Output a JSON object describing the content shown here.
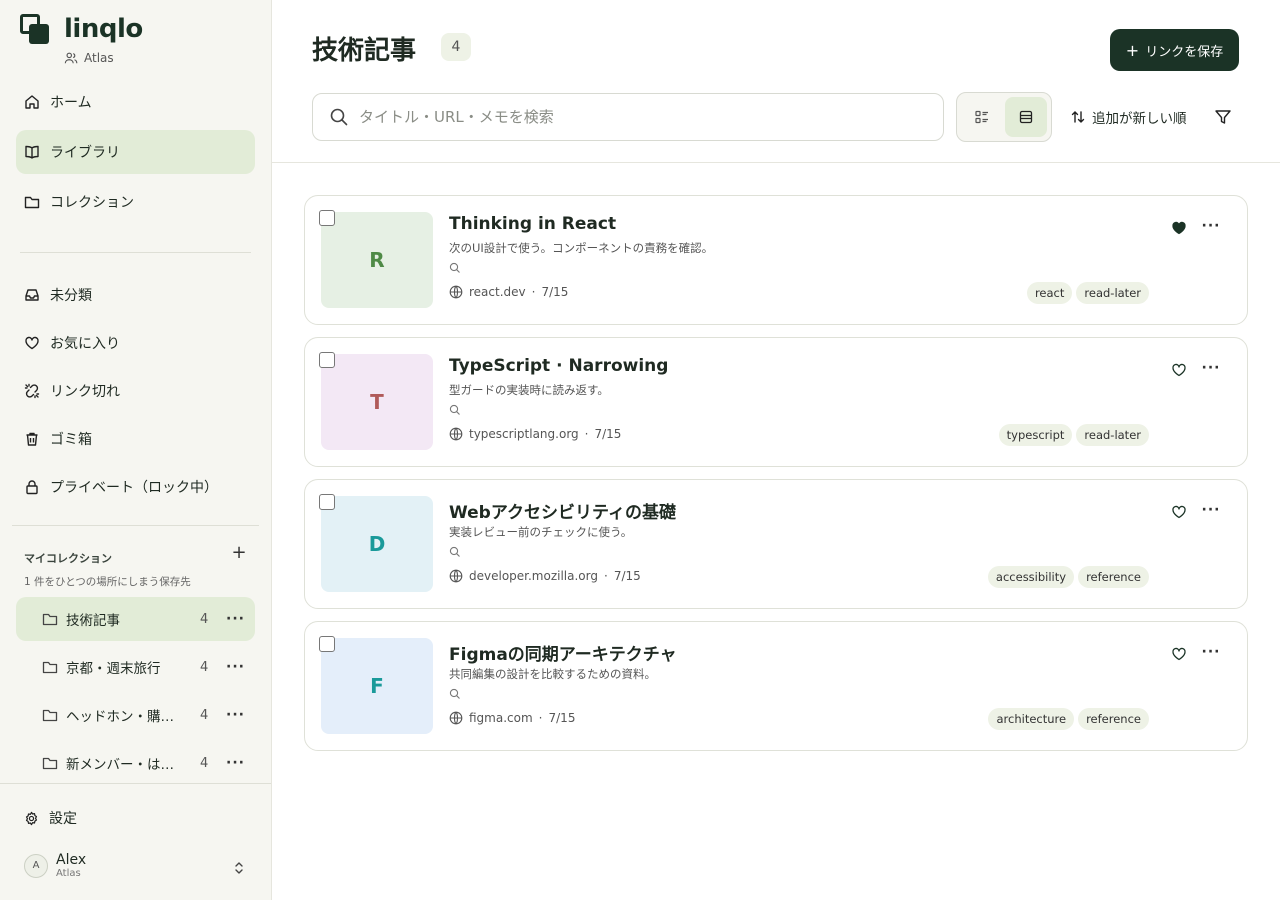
{
  "app": {
    "name": "linqlo",
    "workspace": "Atlas"
  },
  "sidebar": {
    "nav": [
      {
        "label": "ホーム",
        "icon": "home-icon"
      },
      {
        "label": "ライブラリ",
        "icon": "book-icon",
        "active": true
      },
      {
        "label": "コレクション",
        "icon": "folder-icon"
      }
    ],
    "filters": [
      {
        "label": "未分類",
        "icon": "inbox-icon"
      },
      {
        "label": "お気に入り",
        "icon": "heart-icon"
      },
      {
        "label": "リンク切れ",
        "icon": "broken-link-icon"
      },
      {
        "label": "ゴミ箱",
        "icon": "trash-icon"
      },
      {
        "label": "プライベート（ロック中）",
        "icon": "lock-icon"
      }
    ],
    "collections_title": "マイコレクション",
    "collections_desc": "1 件をひとつの場所にしまう保存先",
    "collections": [
      {
        "name": "技術記事",
        "count": "4",
        "active": true
      },
      {
        "name": "京都・週末旅行",
        "count": "4"
      },
      {
        "name": "ヘッドホン・購…",
        "count": "4"
      },
      {
        "name": "新メンバー・は…",
        "count": "4"
      }
    ],
    "settings_label": "設定",
    "user": {
      "initial": "A",
      "name": "Alex",
      "workspace": "Atlas"
    }
  },
  "main": {
    "title": "技術記事",
    "count": "4",
    "save_button": "リンクを保存",
    "search_placeholder": "タイトル・URL・メモを検索",
    "sort_label": "追加が新しい順"
  },
  "colors": {
    "accent": "#1b3326",
    "active_bg": "#e2ecd7"
  },
  "cards": [
    {
      "initial": "R",
      "thumb_bg": "#e6f0e4",
      "thumb_fg": "#4f8a46",
      "title": "Thinking in React",
      "memo": "次のUI設計で使う。コンポーネントの責務を確認。",
      "domain": "react.dev",
      "date": "7/15",
      "tags": [
        "react",
        "read-later"
      ],
      "favorite": true
    },
    {
      "initial": "T",
      "thumb_bg": "#f3e8f5",
      "thumb_fg": "#b05a5a",
      "title": "TypeScript · Narrowing",
      "memo": "型ガードの実装時に読み返す。",
      "domain": "typescriptlang.org",
      "date": "7/15",
      "tags": [
        "typescript",
        "read-later"
      ],
      "favorite": false
    },
    {
      "initial": "D",
      "thumb_bg": "#e3f1f6",
      "thumb_fg": "#1a9a9a",
      "title": "Webアクセシビリティの基礎",
      "memo": "実装レビュー前のチェックに使う。",
      "domain": "developer.mozilla.org",
      "date": "7/15",
      "tags": [
        "accessibility",
        "reference"
      ],
      "favorite": false
    },
    {
      "initial": "F",
      "thumb_bg": "#e4eefa",
      "thumb_fg": "#1a9a9a",
      "title": "Figmaの同期アーキテクチャ",
      "memo": "共同編集の設計を比較するための資料。",
      "domain": "figma.com",
      "date": "7/15",
      "tags": [
        "architecture",
        "reference"
      ],
      "favorite": false
    }
  ]
}
